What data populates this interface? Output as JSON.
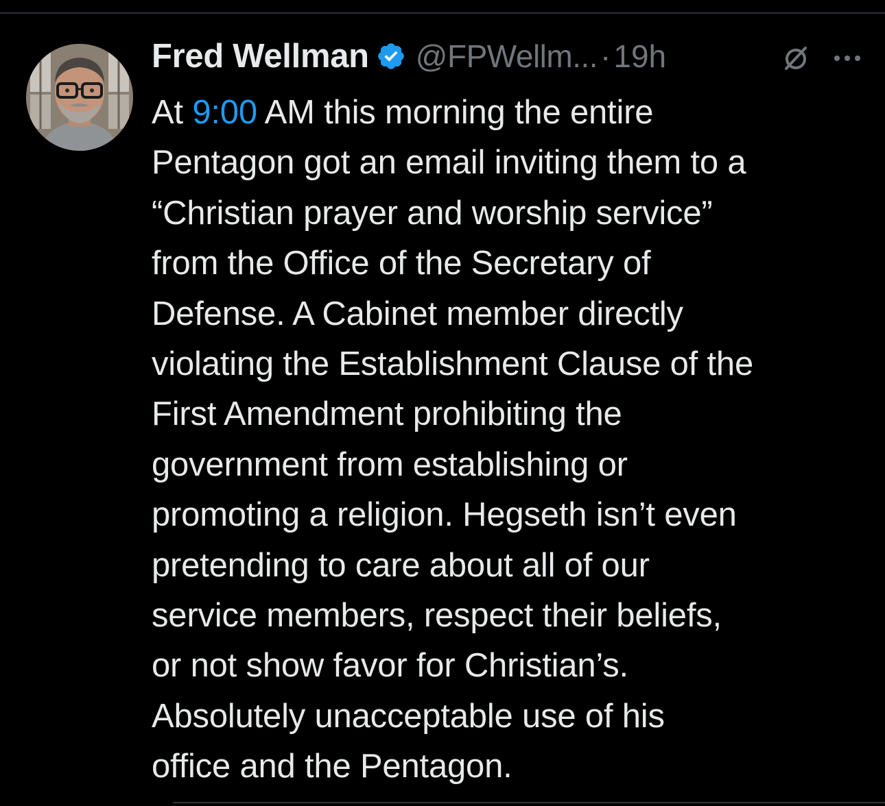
{
  "author": {
    "name": "Fred Wellman",
    "handle": "@FPWellm...",
    "separator": "·",
    "time": "19h",
    "verified": true,
    "verified_color": "#1d9bf0"
  },
  "tweet": {
    "lines": [
      [
        "At ",
        "9:00",
        " AM this morning the entire"
      ],
      "Pentagon got an email inviting them to a",
      "“Christian prayer and worship service”",
      "from the Office of the Secretary of",
      "Defense. A Cabinet member directly",
      "violating the Establishment Clause of the",
      "First Amendment prohibiting the",
      "government from establishing or",
      "promoting a religion. Hegseth isn’t even",
      "pretending to care about all of our",
      "service members, respect their beliefs,",
      "or not show favor for Christian’s.",
      "Absolutely unacceptable use of his",
      "office and the Pentagon."
    ]
  },
  "icons": {
    "avatar": "avatar",
    "verified": "verified-badge-icon",
    "grok": "grok-icon",
    "more": "more-options-icon"
  },
  "colors": {
    "background": "#000000",
    "text": "#e7e9ea",
    "muted": "#71767b",
    "link": "#1d9bf0"
  }
}
